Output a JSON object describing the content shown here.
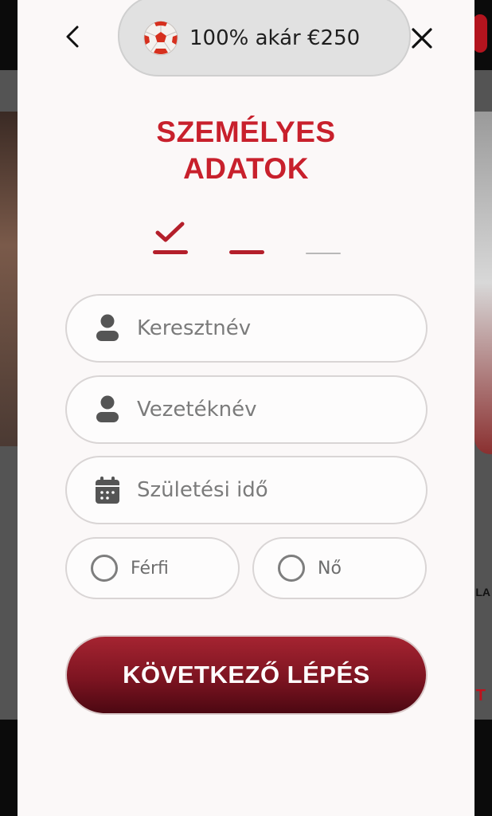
{
  "promo": {
    "text": "100% akár €250",
    "icon": "soccer-ball-icon"
  },
  "header": {
    "back_icon": "chevron-left-icon",
    "close_icon": "close-icon"
  },
  "title": {
    "line1": "SZEMÉLYES",
    "line2": "ADATOK"
  },
  "steps": {
    "total": 3,
    "current": 2,
    "completed": 1
  },
  "form": {
    "first_name": {
      "placeholder": "Keresztnév",
      "value": "",
      "icon": "user-icon"
    },
    "last_name": {
      "placeholder": "Vezetéknév",
      "value": "",
      "icon": "user-icon"
    },
    "birth_date": {
      "placeholder": "Születési idő",
      "value": "",
      "icon": "calendar-icon"
    },
    "gender": {
      "options": [
        "Férfi",
        "Nő"
      ],
      "selected": null
    }
  },
  "next_button": {
    "label": "KÖVETKEZŐ LÉPÉS"
  },
  "background": {
    "side_text": "LA",
    "side_text2": "T"
  },
  "colors": {
    "accent": "#c8202c",
    "button_dark": "#7d1421",
    "modal_bg": "#fbf8f8"
  }
}
